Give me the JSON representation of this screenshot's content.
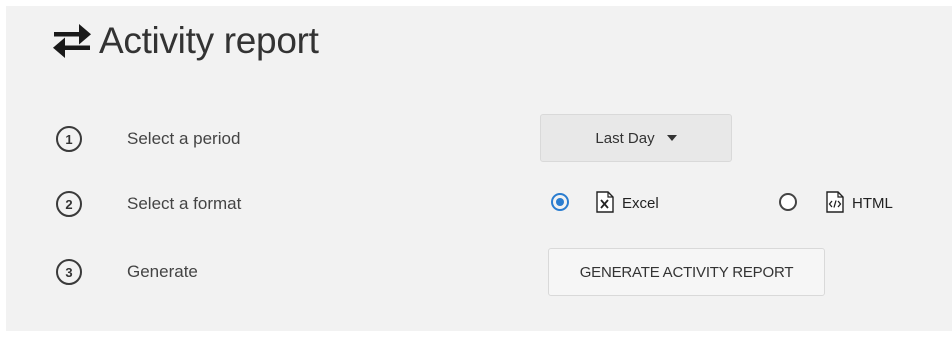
{
  "header": {
    "title": "Activity report",
    "icon": "swap-arrows-icon"
  },
  "steps": [
    {
      "number": "1",
      "label": "Select a period"
    },
    {
      "number": "2",
      "label": "Select a format"
    },
    {
      "number": "3",
      "label": "Generate"
    }
  ],
  "period": {
    "selected": "Last Day"
  },
  "format": {
    "options": [
      {
        "label": "Excel",
        "icon": "excel-file-icon",
        "checked": true
      },
      {
        "label": "HTML",
        "icon": "html-file-icon",
        "checked": false
      }
    ]
  },
  "generate": {
    "button_label": "GENERATE ACTIVITY REPORT"
  },
  "colors": {
    "accent": "#2a7dd0",
    "panel_background": "#f2f2f2"
  }
}
